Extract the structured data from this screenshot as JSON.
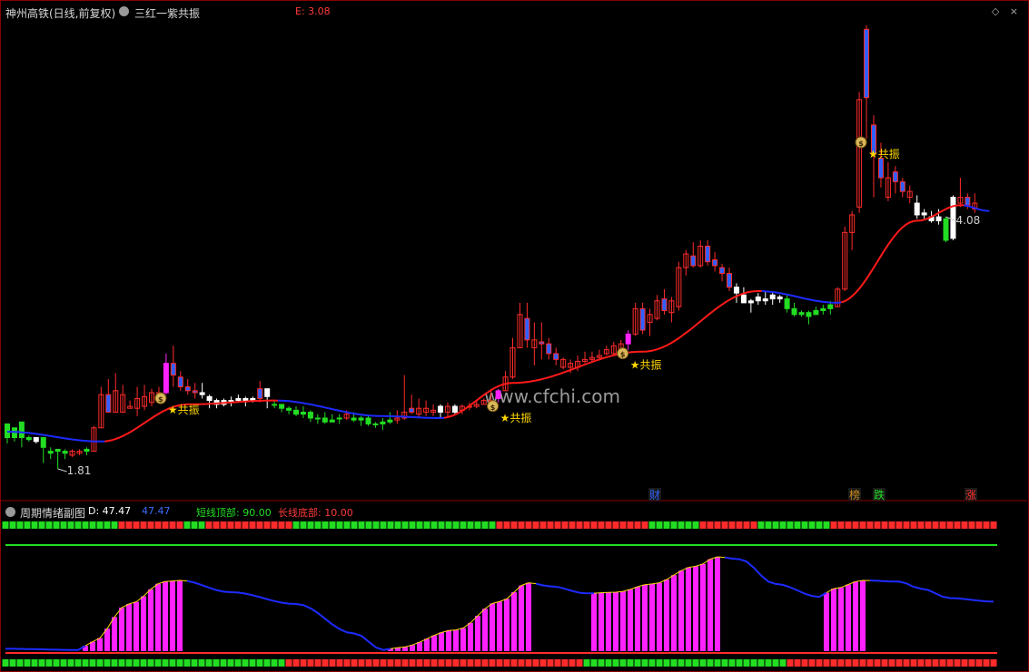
{
  "header": {
    "stock_title": "神州高铁(日线,前复权)",
    "indicator_name": "三红一紫共振",
    "indicator_value": "E: 3.08",
    "window_icons": "◇ ×"
  },
  "sub_header": {
    "title": "周期情绪副图",
    "d_value": "D: 47.47",
    "d_value2": "47.47",
    "short_top": "短线顶部: 90.00",
    "long_bottom": "长线底部: 10.00"
  },
  "watermark": "www.cfchi.com",
  "colors": {
    "up": "#ff2b2b",
    "down_blue": "#3060ff",
    "down_green": "#22dd22",
    "magenta": "#ff22ff",
    "white": "#ffffff",
    "ma_blue": "#1d2bff",
    "ma_red": "#ff1a1a",
    "signal": "#ffd700"
  },
  "chart_data": [
    {
      "type": "candlestick",
      "title": "三红一紫共振",
      "price_range": [
        1.81,
        4.08
      ],
      "annotations": {
        "high_label": "4.08",
        "low_label": "1.81",
        "signal_text": "★共振"
      },
      "event_labels": [
        "财",
        "榜",
        "跌",
        "涨"
      ],
      "candles": [
        [
          1.97,
          2.04,
          1.97,
          1.94,
          "g"
        ],
        [
          1.97,
          2.02,
          2.02,
          1.95,
          "g"
        ],
        [
          1.97,
          2.05,
          1.97,
          1.92,
          "g"
        ],
        [
          1.97,
          1.96,
          1.98,
          1.95,
          "g"
        ],
        [
          1.97,
          1.95,
          1.97,
          1.94,
          "w"
        ],
        [
          1.97,
          1.92,
          1.97,
          1.84,
          "g"
        ],
        [
          1.9,
          1.89,
          1.92,
          1.86,
          "g"
        ],
        [
          1.91,
          1.9,
          1.91,
          1.81,
          "g"
        ],
        [
          1.9,
          1.89,
          1.91,
          1.86,
          "g"
        ],
        [
          1.88,
          1.9,
          1.91,
          1.87,
          "r"
        ],
        [
          1.89,
          1.9,
          1.91,
          1.88,
          "r"
        ],
        [
          1.9,
          1.91,
          1.92,
          1.88,
          "g"
        ],
        [
          1.9,
          2.02,
          2.03,
          1.9,
          "r"
        ],
        [
          2.02,
          2.19,
          2.23,
          2.02,
          "r"
        ],
        [
          2.19,
          2.1,
          2.27,
          2.1,
          "b"
        ],
        [
          2.1,
          2.21,
          2.3,
          2.1,
          "r"
        ],
        [
          2.1,
          2.19,
          2.24,
          2.1,
          "r"
        ],
        [
          2.12,
          2.13,
          2.16,
          2.12,
          "r"
        ],
        [
          2.12,
          2.17,
          2.23,
          2.08,
          "r"
        ],
        [
          2.13,
          2.18,
          2.24,
          2.11,
          "r"
        ],
        [
          2.15,
          2.2,
          2.22,
          2.13,
          "r"
        ],
        [
          2.18,
          2.2,
          2.23,
          2.15,
          "r"
        ],
        [
          2.2,
          2.35,
          2.4,
          2.19,
          "m"
        ],
        [
          2.35,
          2.29,
          2.44,
          2.23,
          "b"
        ],
        [
          2.28,
          2.23,
          2.31,
          2.21,
          "b"
        ],
        [
          2.23,
          2.21,
          2.27,
          2.19,
          "b"
        ],
        [
          2.21,
          2.2,
          2.25,
          2.17,
          "b"
        ],
        [
          2.2,
          2.19,
          2.25,
          2.17,
          "w"
        ],
        [
          2.18,
          2.16,
          2.19,
          2.12,
          "w"
        ],
        [
          2.16,
          2.14,
          2.17,
          2.12,
          "w"
        ],
        [
          2.14,
          2.16,
          2.17,
          2.13,
          "w"
        ],
        [
          2.16,
          2.16,
          2.18,
          2.13,
          "w"
        ],
        [
          2.16,
          2.17,
          2.19,
          2.15,
          "w"
        ],
        [
          2.17,
          2.16,
          2.18,
          2.13,
          "w"
        ],
        [
          2.16,
          2.17,
          2.18,
          2.15,
          "w"
        ],
        [
          2.17,
          2.22,
          2.26,
          2.15,
          "b"
        ],
        [
          2.22,
          2.18,
          2.22,
          2.12,
          "w"
        ],
        [
          2.14,
          2.14,
          2.16,
          2.12,
          "g"
        ],
        [
          2.14,
          2.12,
          2.14,
          2.1,
          "g"
        ],
        [
          2.12,
          2.11,
          2.13,
          2.09,
          "g"
        ],
        [
          2.11,
          2.09,
          2.13,
          2.08,
          "g"
        ],
        [
          2.09,
          2.1,
          2.13,
          2.07,
          "g"
        ],
        [
          2.1,
          2.07,
          2.11,
          2.05,
          "g"
        ],
        [
          2.07,
          2.07,
          2.09,
          2.04,
          "g"
        ],
        [
          2.07,
          2.05,
          2.1,
          2.04,
          "g"
        ],
        [
          2.05,
          2.06,
          2.09,
          2.05,
          "g"
        ],
        [
          2.07,
          2.07,
          2.09,
          2.04,
          "g"
        ],
        [
          2.07,
          2.09,
          2.11,
          2.06,
          "r"
        ],
        [
          2.07,
          2.06,
          2.1,
          2.05,
          "g"
        ],
        [
          2.06,
          2.07,
          2.08,
          2.03,
          "g"
        ],
        [
          2.07,
          2.04,
          2.08,
          2.03,
          "g"
        ],
        [
          2.04,
          2.04,
          2.05,
          2.02,
          "g"
        ],
        [
          2.04,
          2.05,
          2.07,
          2.01,
          "g"
        ],
        [
          2.05,
          2.06,
          2.1,
          2.04,
          "g"
        ],
        [
          2.06,
          2.07,
          2.11,
          2.04,
          "r"
        ],
        [
          2.07,
          2.1,
          2.29,
          2.06,
          "r"
        ],
        [
          2.1,
          2.12,
          2.19,
          2.09,
          "b"
        ],
        [
          2.12,
          2.09,
          2.17,
          2.07,
          "r"
        ],
        [
          2.1,
          2.12,
          2.16,
          2.08,
          "r"
        ],
        [
          2.1,
          2.11,
          2.14,
          2.08,
          "r"
        ],
        [
          2.13,
          2.1,
          2.14,
          2.07,
          "w"
        ],
        [
          2.1,
          2.13,
          2.15,
          2.08,
          "r"
        ],
        [
          2.13,
          2.1,
          2.14,
          2.09,
          "w"
        ],
        [
          2.11,
          2.13,
          2.14,
          2.09,
          "r"
        ],
        [
          2.13,
          2.13,
          2.15,
          2.11,
          "r"
        ],
        [
          2.13,
          2.14,
          2.16,
          2.12,
          "r"
        ],
        [
          2.14,
          2.16,
          2.17,
          2.14,
          "r"
        ],
        [
          2.16,
          2.16,
          2.22,
          2.14,
          "r"
        ],
        [
          2.17,
          2.21,
          2.22,
          2.15,
          "m"
        ],
        [
          2.21,
          2.28,
          2.31,
          2.21,
          "r"
        ],
        [
          2.28,
          2.43,
          2.48,
          2.27,
          "r"
        ],
        [
          2.43,
          2.6,
          2.66,
          2.43,
          "r"
        ],
        [
          2.58,
          2.47,
          2.66,
          2.43,
          "b"
        ],
        [
          2.47,
          2.43,
          2.56,
          2.34,
          "r"
        ],
        [
          2.46,
          2.45,
          2.56,
          2.37,
          "b"
        ],
        [
          2.45,
          2.4,
          2.48,
          2.37,
          "b"
        ],
        [
          2.4,
          2.37,
          2.43,
          2.34,
          "b"
        ],
        [
          2.37,
          2.33,
          2.38,
          2.32,
          "r"
        ],
        [
          2.33,
          2.35,
          2.37,
          2.3,
          "r"
        ],
        [
          2.33,
          2.36,
          2.39,
          2.31,
          "r"
        ],
        [
          2.36,
          2.37,
          2.41,
          2.35,
          "r"
        ],
        [
          2.37,
          2.38,
          2.41,
          2.36,
          "r"
        ],
        [
          2.38,
          2.39,
          2.42,
          2.37,
          "r"
        ],
        [
          2.4,
          2.42,
          2.44,
          2.39,
          "r"
        ],
        [
          2.4,
          2.44,
          2.46,
          2.39,
          "r"
        ],
        [
          2.42,
          2.45,
          2.47,
          2.41,
          "r"
        ],
        [
          2.45,
          2.5,
          2.52,
          2.42,
          "m"
        ],
        [
          2.5,
          2.63,
          2.66,
          2.49,
          "r"
        ],
        [
          2.63,
          2.52,
          2.66,
          2.5,
          "b"
        ],
        [
          2.56,
          2.6,
          2.63,
          2.49,
          "r"
        ],
        [
          2.58,
          2.67,
          2.7,
          2.57,
          "r"
        ],
        [
          2.68,
          2.62,
          2.73,
          2.6,
          "b"
        ],
        [
          2.61,
          2.67,
          2.69,
          2.56,
          "r"
        ],
        [
          2.64,
          2.84,
          2.87,
          2.62,
          "r"
        ],
        [
          2.84,
          2.91,
          2.93,
          2.8,
          "r"
        ],
        [
          2.9,
          2.85,
          2.97,
          2.84,
          "b"
        ],
        [
          2.85,
          2.95,
          2.98,
          2.84,
          "r"
        ],
        [
          2.95,
          2.87,
          2.98,
          2.85,
          "b"
        ],
        [
          2.88,
          2.85,
          2.92,
          2.82,
          "b"
        ],
        [
          2.84,
          2.81,
          2.86,
          2.77,
          "b"
        ],
        [
          2.81,
          2.74,
          2.84,
          2.72,
          "b"
        ],
        [
          2.74,
          2.71,
          2.76,
          2.66,
          "w"
        ],
        [
          2.7,
          2.66,
          2.74,
          2.66,
          "w"
        ],
        [
          2.67,
          2.66,
          2.68,
          2.61,
          "w"
        ],
        [
          2.67,
          2.69,
          2.71,
          2.65,
          "w"
        ],
        [
          2.68,
          2.67,
          2.72,
          2.65,
          "w"
        ],
        [
          2.68,
          2.7,
          2.72,
          2.65,
          "w"
        ],
        [
          2.69,
          2.68,
          2.7,
          2.66,
          "w"
        ],
        [
          2.68,
          2.63,
          2.7,
          2.61,
          "g"
        ],
        [
          2.63,
          2.6,
          2.66,
          2.59,
          "g"
        ],
        [
          2.6,
          2.61,
          2.62,
          2.59,
          "g"
        ],
        [
          2.61,
          2.59,
          2.62,
          2.55,
          "g"
        ],
        [
          2.6,
          2.62,
          2.64,
          2.6,
          "g"
        ],
        [
          2.62,
          2.63,
          2.65,
          2.6,
          "g"
        ],
        [
          2.63,
          2.65,
          2.67,
          2.6,
          "g"
        ],
        [
          2.64,
          2.73,
          2.74,
          2.64,
          "r"
        ],
        [
          2.73,
          3.02,
          3.05,
          2.72,
          "r"
        ],
        [
          3.02,
          3.11,
          3.13,
          2.93,
          "r"
        ],
        [
          3.15,
          3.7,
          3.74,
          3.12,
          "r"
        ],
        [
          4.06,
          3.71,
          4.08,
          3.5,
          "b"
        ],
        [
          3.57,
          3.42,
          3.62,
          3.2,
          "b"
        ],
        [
          3.4,
          3.3,
          3.48,
          3.25,
          "b"
        ],
        [
          3.3,
          3.2,
          3.38,
          3.18,
          "r"
        ],
        [
          3.33,
          3.28,
          3.36,
          3.22,
          "b"
        ],
        [
          3.28,
          3.23,
          3.3,
          3.2,
          "b"
        ],
        [
          3.23,
          3.2,
          3.26,
          3.17,
          "r"
        ],
        [
          3.17,
          3.11,
          3.21,
          3.09,
          "w"
        ],
        [
          3.12,
          3.11,
          3.14,
          3.09,
          "w"
        ],
        [
          3.1,
          3.08,
          3.13,
          3.07,
          "w"
        ],
        [
          3.08,
          3.1,
          3.14,
          3.06,
          "w"
        ],
        [
          3.09,
          2.98,
          3.1,
          2.97,
          "g"
        ],
        [
          2.99,
          3.2,
          3.21,
          2.98,
          "w"
        ],
        [
          3.17,
          3.2,
          3.3,
          3.15,
          "r"
        ],
        [
          3.2,
          3.16,
          3.22,
          3.14,
          "b"
        ],
        [
          3.17,
          3.14,
          3.22,
          3.12,
          "r"
        ]
      ],
      "ma_line": [
        {
          "t": 0,
          "v": 2.0,
          "c": "blue"
        },
        {
          "t": 13,
          "v": 1.95,
          "c": "red"
        },
        {
          "t": 25,
          "v": 2.14,
          "c": "red"
        },
        {
          "t": 37,
          "v": 2.16,
          "c": "blue"
        },
        {
          "t": 52,
          "v": 2.08,
          "c": "blue"
        },
        {
          "t": 60,
          "v": 2.07,
          "c": "red"
        },
        {
          "t": 70,
          "v": 2.25,
          "c": "red"
        },
        {
          "t": 88,
          "v": 2.41,
          "c": "red"
        },
        {
          "t": 104,
          "v": 2.72,
          "c": "blue"
        },
        {
          "t": 115,
          "v": 2.66,
          "c": "red"
        },
        {
          "t": 126,
          "v": 3.08,
          "c": "red"
        },
        {
          "t": 132,
          "v": 3.16,
          "c": "blue"
        },
        {
          "t": 136,
          "v": 3.13,
          "c": "red"
        }
      ],
      "signals": [
        {
          "t": 22,
          "label": "★共振"
        },
        {
          "t": 68,
          "label": "★共振"
        },
        {
          "t": 86,
          "label": "★共振"
        },
        {
          "t": 119,
          "label": "★共振"
        }
      ]
    },
    {
      "type": "area",
      "title": "周期情绪副图",
      "ylim": [
        0,
        100
      ],
      "series": [
        {
          "name": "D",
          "points": [
            [
              0,
              2
            ],
            [
              10,
              1
            ],
            [
              12,
              8
            ],
            [
              17,
              40
            ],
            [
              22,
              59
            ],
            [
              24,
              60
            ],
            [
              31,
              50
            ],
            [
              40,
              40
            ],
            [
              48,
              15
            ],
            [
              52,
              1
            ],
            [
              54,
              3
            ],
            [
              62,
              18
            ],
            [
              68,
              42
            ],
            [
              72,
              58
            ],
            [
              75,
              55
            ],
            [
              80,
              49
            ],
            [
              84,
              50
            ],
            [
              89,
              57
            ],
            [
              95,
              72
            ],
            [
              98,
              80
            ],
            [
              101,
              78
            ],
            [
              106,
              57
            ],
            [
              112,
              46
            ],
            [
              114,
              53
            ],
            [
              118,
              60
            ],
            [
              123,
              59
            ],
            [
              126,
              53
            ],
            [
              130,
              45
            ],
            [
              136,
              42
            ]
          ]
        }
      ],
      "bar_count": 137,
      "top_strip_green_ranges": [
        [
          0,
          15
        ],
        [
          25,
          27
        ],
        [
          40,
          67
        ],
        [
          89,
          95
        ],
        [
          104,
          113
        ]
      ],
      "bottom_strip_green_ranges": [
        [
          0,
          38
        ],
        [
          80,
          107
        ]
      ]
    }
  ]
}
